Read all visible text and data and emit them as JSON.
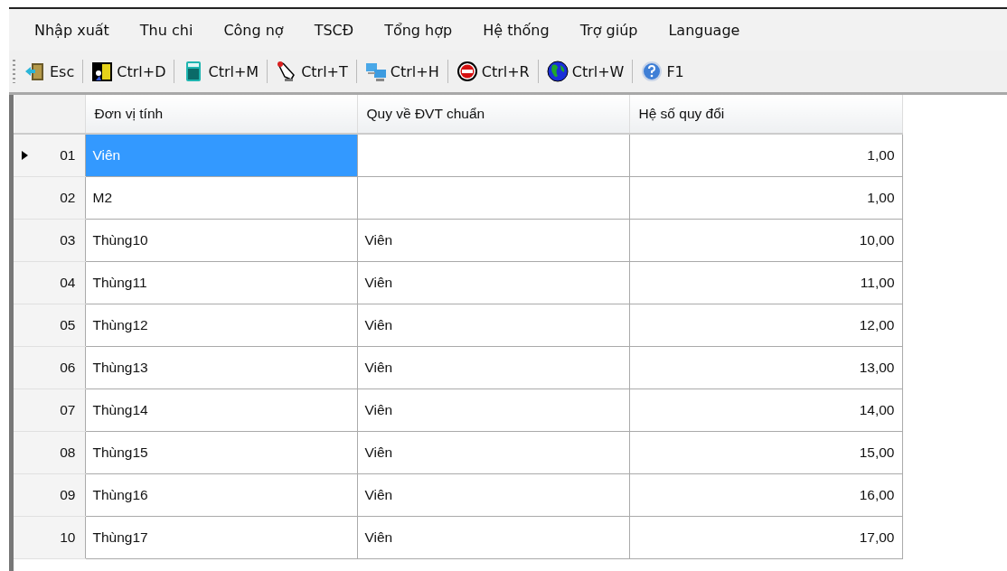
{
  "menu": [
    "Nhập xuất",
    "Thu chi",
    "Công nợ",
    "TSCĐ",
    "Tổng hợp",
    "Hệ thống",
    "Trợ giúp",
    "Language"
  ],
  "toolbar": [
    "Esc",
    "Ctrl+D",
    "Ctrl+M",
    "Ctrl+T",
    "Ctrl+H",
    "Ctrl+R",
    "Ctrl+W",
    "F1"
  ],
  "table": {
    "columns": [
      "Đơn vị tính",
      "Quy về ĐVT chuẩn",
      "Hệ số quy đổi"
    ],
    "rows": [
      {
        "number": "01",
        "unit": "Viên",
        "base_unit": "",
        "factor": "1,00",
        "selected": true
      },
      {
        "number": "02",
        "unit": "M2",
        "base_unit": "",
        "factor": "1,00",
        "selected": false
      },
      {
        "number": "03",
        "unit": "Thùng10",
        "base_unit": "Viên",
        "factor": "10,00",
        "selected": false
      },
      {
        "number": "04",
        "unit": "Thùng11",
        "base_unit": "Viên",
        "factor": "11,00",
        "selected": false
      },
      {
        "number": "05",
        "unit": "Thùng12",
        "base_unit": "Viên",
        "factor": "12,00",
        "selected": false
      },
      {
        "number": "06",
        "unit": "Thùng13",
        "base_unit": "Viên",
        "factor": "13,00",
        "selected": false
      },
      {
        "number": "07",
        "unit": "Thùng14",
        "base_unit": "Viên",
        "factor": "14,00",
        "selected": false
      },
      {
        "number": "08",
        "unit": "Thùng15",
        "base_unit": "Viên",
        "factor": "15,00",
        "selected": false
      },
      {
        "number": "09",
        "unit": "Thùng16",
        "base_unit": "Viên",
        "factor": "16,00",
        "selected": false
      },
      {
        "number": "10",
        "unit": "Thùng17",
        "base_unit": "Viên",
        "factor": "17,00",
        "selected": false
      }
    ]
  }
}
